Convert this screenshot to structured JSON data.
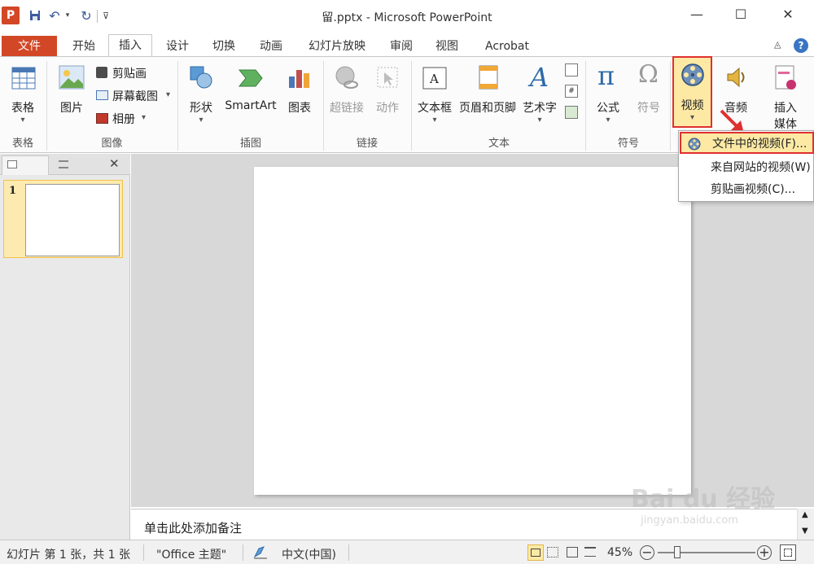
{
  "window": {
    "title": "留.pptx - Microsoft PowerPoint",
    "minimize_glyph": "—",
    "maximize_glyph": "☐",
    "close_glyph": "✕"
  },
  "quick_access": {
    "app_icon_letter": "P",
    "customize_glyph": "⊽"
  },
  "tabs": [
    {
      "label": "文件"
    },
    {
      "label": "开始"
    },
    {
      "label": "插入"
    },
    {
      "label": "设计"
    },
    {
      "label": "切换"
    },
    {
      "label": "动画"
    },
    {
      "label": "幻灯片放映"
    },
    {
      "label": "审阅"
    },
    {
      "label": "视图"
    },
    {
      "label": "Acrobat"
    }
  ],
  "ribbon": {
    "groups": {
      "table": "表格",
      "image": "图像",
      "illustration": "插图",
      "link": "链接",
      "text": "文本",
      "symbol": "符号"
    },
    "buttons": {
      "table": "表格",
      "picture": "图片",
      "clipart": "剪贴画",
      "screenshot": "屏幕截图",
      "album": "相册",
      "shape": "形状",
      "smartart": "SmartArt",
      "chart": "图表",
      "hyperlink": "超链接",
      "action": "动作",
      "textbox": "文本框",
      "header_footer": "页眉和页脚",
      "wordart": "艺术字",
      "equation": "公式",
      "symbol": "符号",
      "video": "视频",
      "audio": "音频",
      "insert_media_1": "插入",
      "insert_media_2": "媒体"
    },
    "glyphs": {
      "pi": "π",
      "omega": "Ω",
      "wordart_a": "A",
      "dropdown": "▾"
    }
  },
  "video_menu": {
    "items": [
      {
        "label": "文件中的视频(F)..."
      },
      {
        "label": "来自网站的视频(W)"
      },
      {
        "label": "剪贴画视频(C)..."
      }
    ]
  },
  "left_pane": {
    "slide_number": "1",
    "close_glyph": "✕"
  },
  "notes": {
    "placeholder": "单击此处添加备注"
  },
  "status": {
    "slide_info": "幻灯片 第 1 张，共 1 张",
    "theme": "\"Office 主题\"",
    "language": "中文(中国)",
    "zoom": "45%"
  },
  "watermark": {
    "line1": "Bai du 经验",
    "line2": "jingyan.baidu.com"
  },
  "colors": {
    "file_tab": "#d24726",
    "highlight": "#fde9a4",
    "annotation_red": "#e03030",
    "slide_selection": "#f2c14e"
  }
}
